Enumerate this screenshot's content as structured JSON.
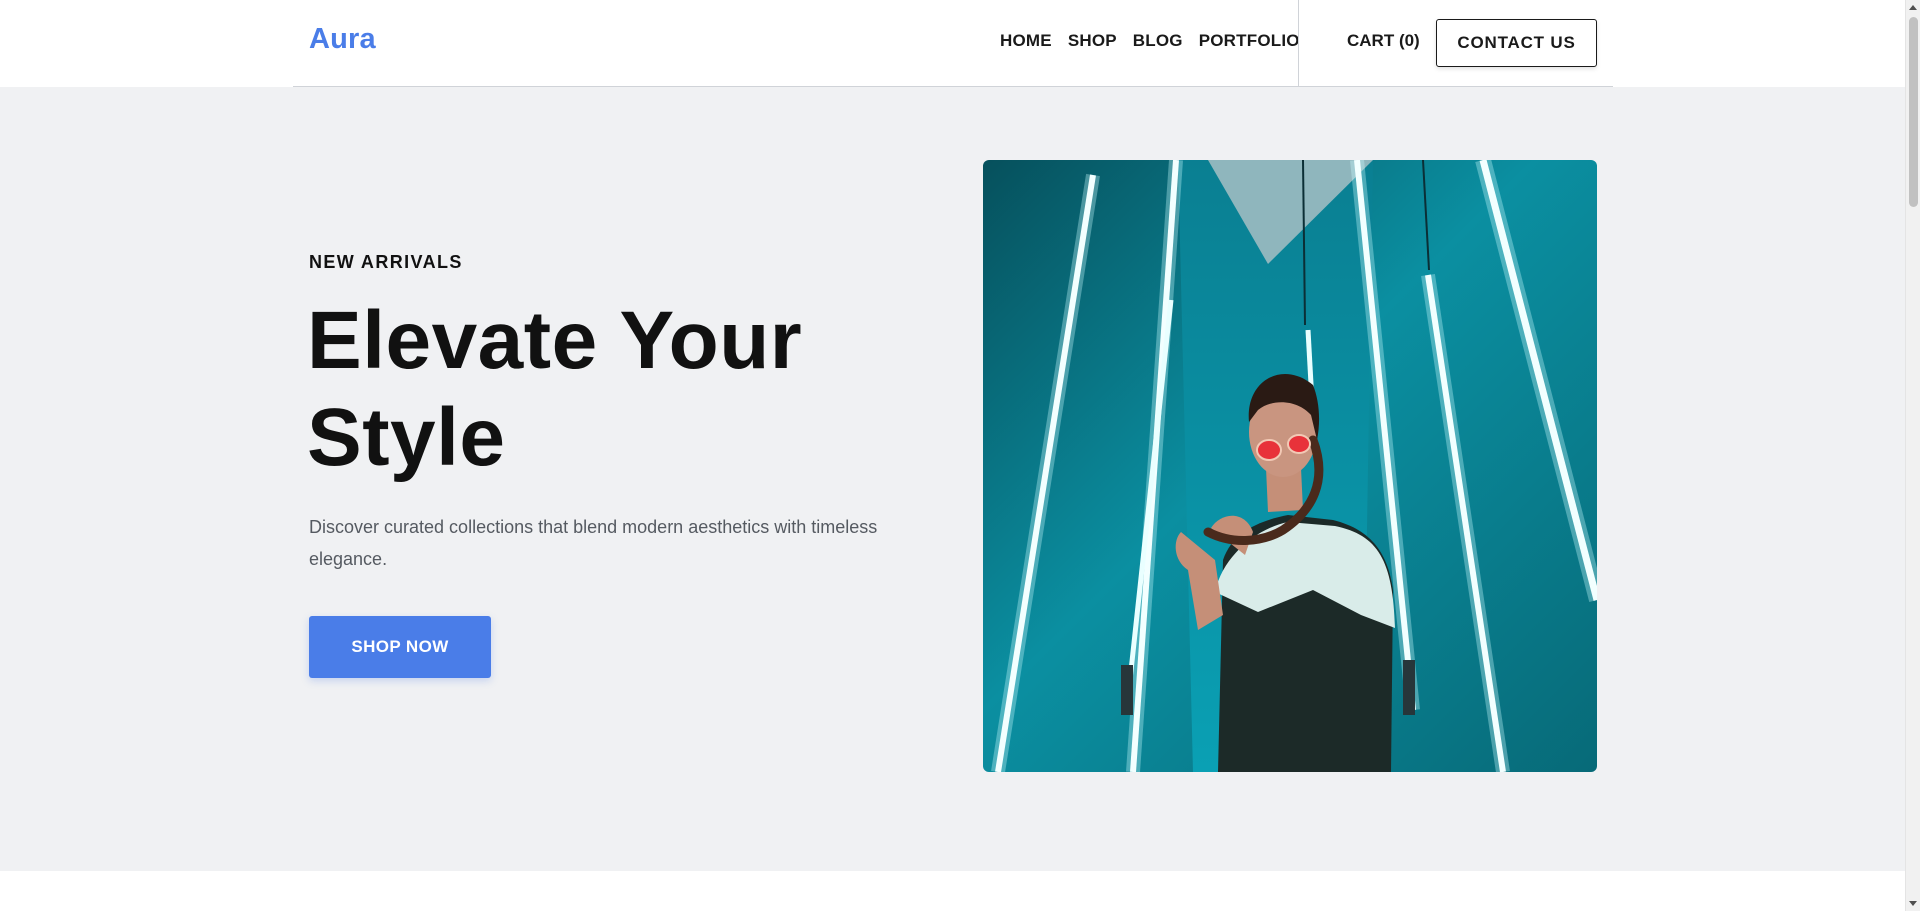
{
  "header": {
    "logo": "Aura",
    "nav": [
      {
        "label": "HOME"
      },
      {
        "label": "SHOP"
      },
      {
        "label": "BLOG"
      },
      {
        "label": "PORTFOLIO"
      }
    ],
    "cart_label": "CART (0)",
    "contact_label": "CONTACT US"
  },
  "hero": {
    "eyebrow": "NEW ARRIVALS",
    "headline_line1": "Elevate Your",
    "headline_line2": "Style",
    "subtitle": "Discover curated collections that blend modern aesthetics with timeless elegance.",
    "cta_label": "SHOP NOW",
    "image_icon": "fashion-model-photo"
  },
  "colors": {
    "accent": "#4a7de8",
    "hero_background": "#f0f1f3",
    "text_primary": "#111111",
    "text_secondary": "#555a61",
    "photo_teal": "#0a8a9c"
  }
}
